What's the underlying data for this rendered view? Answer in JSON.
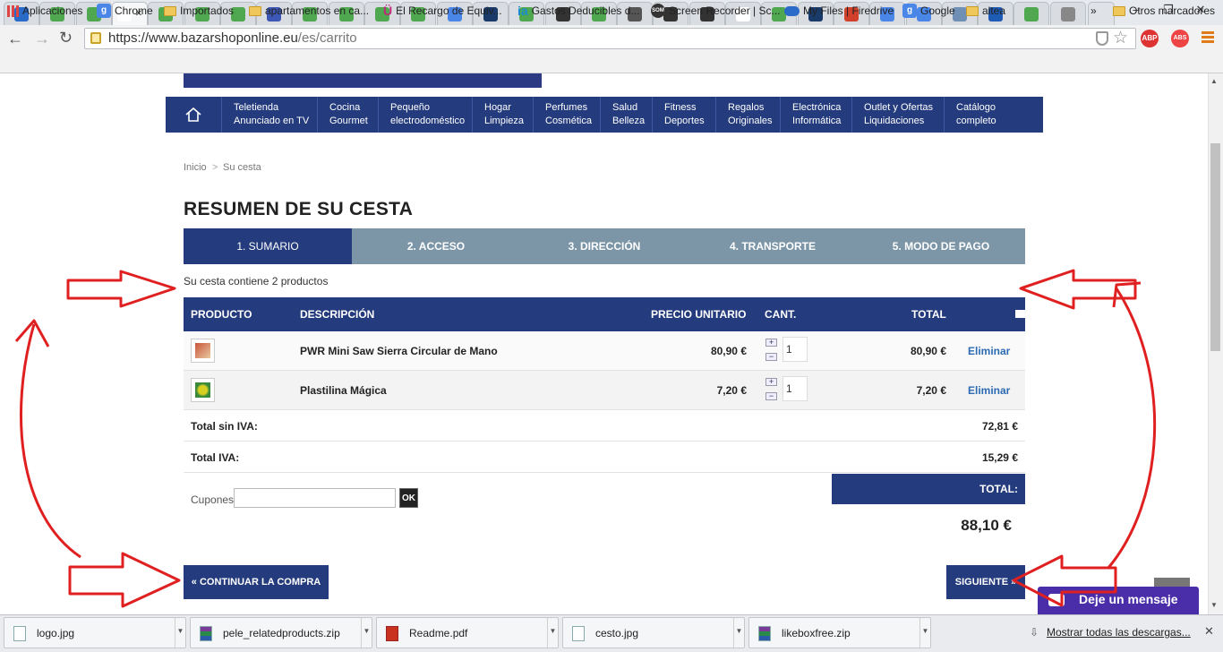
{
  "browser": {
    "url_prefix": "https://www.bazarshoponline.eu",
    "url_path": "/es/carrito",
    "bookmarks": [
      "Aplicaciones",
      "Chrome",
      "Importados",
      "apartamentos en ca...",
      "El Recargo de Equiv...",
      "Gastos Deducibles d...",
      "Screen Recorder | Sc...",
      "My Files | Firedrive",
      "Google",
      "altea"
    ],
    "bookmarks_overflow": "»",
    "other_bookmarks": "Otros marcadores",
    "tab_favicon_colors": [
      "#2a6ac9",
      "#4fa84f",
      "#4fa84f",
      "#ffffff",
      "#4fa84f",
      "#4fa84f",
      "#4fa84f",
      "#3c57b5",
      "#4fa84f",
      "#4fa84f",
      "#4fa84f",
      "#4fa84f",
      "#4a86e8",
      "#1a3a6a",
      "#4fa84f",
      "#333333",
      "#4fa84f",
      "#555555",
      "#333333",
      "#333333",
      "#ffffff",
      "#4fa84f",
      "#1a3a6a",
      "#d0402a",
      "#4a86e8",
      "#4a86e8",
      "#6f8fb5",
      "#1e5bb5",
      "#4fa84f",
      "#888888"
    ]
  },
  "site": {
    "nav": [
      {
        "l1": "Teletienda",
        "l2": "Anunciado en TV"
      },
      {
        "l1": "Cocina",
        "l2": "Gourmet"
      },
      {
        "l1": "Pequeño",
        "l2": "electrodoméstico"
      },
      {
        "l1": "Hogar",
        "l2": "Limpieza"
      },
      {
        "l1": "Perfumes",
        "l2": "Cosmética"
      },
      {
        "l1": "Salud",
        "l2": "Belleza"
      },
      {
        "l1": "Fitness",
        "l2": "Deportes"
      },
      {
        "l1": "Regalos",
        "l2": "Originales"
      },
      {
        "l1": "Electrónica",
        "l2": "Informática"
      },
      {
        "l1": "Outlet y Ofertas",
        "l2": "Liquidaciones"
      },
      {
        "l1": "Catálogo",
        "l2": "completo"
      }
    ],
    "breadcrumb": {
      "home": "Inicio",
      "sep": ">",
      "current": "Su cesta"
    },
    "title": "RESUMEN DE SU CESTA",
    "steps": [
      "1. SUMARIO",
      "2. ACCESO",
      "3. DIRECCIÓN",
      "4. TRANSPORTE",
      "5. MODO DE PAGO"
    ],
    "count_text": "Su cesta contiene 2 productos",
    "table": {
      "headers": [
        "PRODUCTO",
        "DESCRIPCIÓN",
        "PRECIO UNITARIO",
        "CANT.",
        "TOTAL"
      ],
      "rows": [
        {
          "description": "PWR Mini Saw Sierra Circular de Mano",
          "unit_price": "80,90 €",
          "qty": "1",
          "total": "80,90 €",
          "remove": "Eliminar"
        },
        {
          "description": "Plastilina Mágica",
          "unit_price": "7,20 €",
          "qty": "1",
          "total": "7,20 €",
          "remove": "Eliminar"
        }
      ]
    },
    "summary": {
      "subtotal_label": "Total sin IVA:",
      "subtotal": "72,81 €",
      "tax_label": "Total IVA:",
      "tax": "15,29 €",
      "total_label": "TOTAL:",
      "total": "88,10 €"
    },
    "coupon_label": "Cupones",
    "coupon_ok": "OK",
    "continue_btn": "« CONTINUAR LA COMPRA",
    "next_btn": "SIGUIENTE »",
    "chat": "Deje un mensaje"
  },
  "downloads": {
    "items": [
      "logo.jpg",
      "pele_relatedproducts.zip",
      "Readme.pdf",
      "cesto.jpg",
      "likeboxfree.zip"
    ],
    "show_all": "Mostrar todas las descargas..."
  },
  "colors": {
    "nav": "#243b7d",
    "steps_inactive": "#7c96a8",
    "annotation": "#e02020",
    "link": "#2c6bb3"
  }
}
